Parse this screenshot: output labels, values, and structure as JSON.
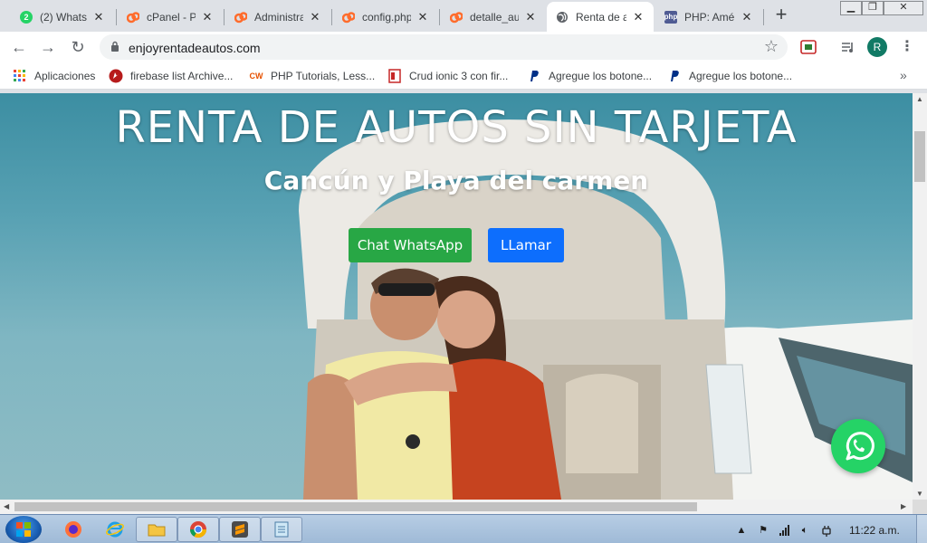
{
  "tabs": [
    {
      "title": "(2) WhatsApp",
      "icon": "whatsapp-icon",
      "badge": "2"
    },
    {
      "title": "cPanel - Pr",
      "icon": "cpanel-icon"
    },
    {
      "title": "Administra",
      "icon": "cpanel-icon"
    },
    {
      "title": "config.php",
      "icon": "cpanel-icon"
    },
    {
      "title": "detalle_aut",
      "icon": "cpanel-icon"
    },
    {
      "title": "Renta de a",
      "icon": "globe-icon",
      "active": true
    },
    {
      "title": "PHP: Amé",
      "icon": "php-icon",
      "php_label": "php"
    }
  ],
  "toolbar": {
    "url": "enjoyrentadeautos.com",
    "profile_initial": "R"
  },
  "bookmarks": [
    {
      "label": "Aplicaciones",
      "icon": "apps-grid-icon"
    },
    {
      "label": "firebase list Archive...",
      "icon": "firebase-icon"
    },
    {
      "label": "PHP Tutorials, Less...",
      "icon": "cw-icon",
      "icon_text": "CW"
    },
    {
      "label": "Crud ionic 3 con fir...",
      "icon": "bookmark-page-icon"
    },
    {
      "label": "Agregue los botone...",
      "icon": "paypal-icon"
    },
    {
      "label": "Agregue los botone...",
      "icon": "paypal-icon"
    }
  ],
  "hero": {
    "title": "RENTA DE AUTOS SIN TARJETA",
    "subtitle": "Cancún y Playa del carmen",
    "whatsapp_button": "Chat WhatsApp",
    "call_button": "LLamar"
  },
  "taskbar": {
    "clock": "11:22 a.m."
  },
  "colors": {
    "whatsapp_green": "#28a745",
    "call_blue": "#0d6efd",
    "float_green": "#25d366"
  }
}
